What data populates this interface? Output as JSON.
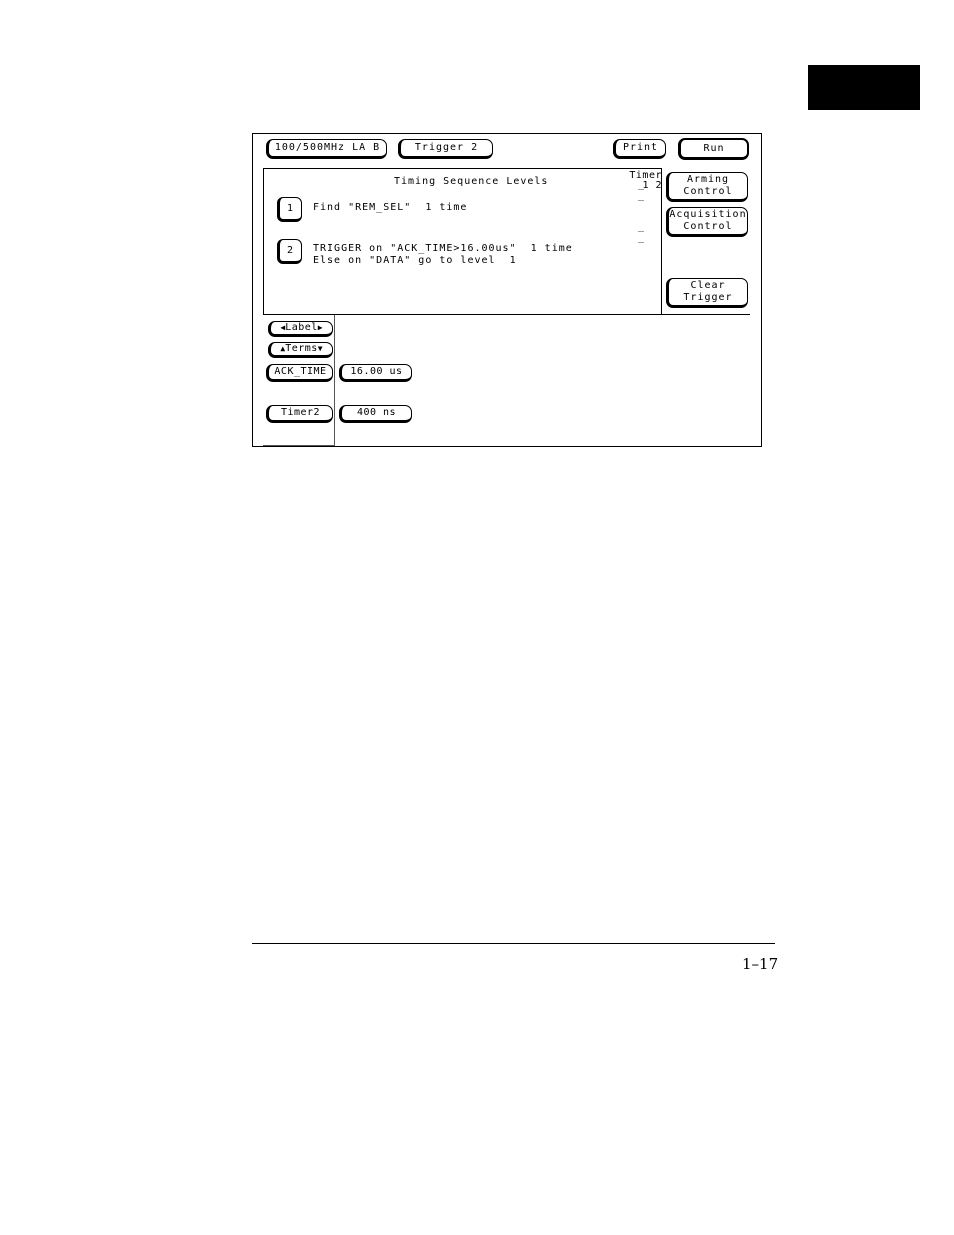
{
  "header": {
    "analyzer_label": "100/500MHz LA B",
    "menu_label": "Trigger 2",
    "print_label": "Print",
    "run_label": "Run"
  },
  "sequence": {
    "title": "Timing Sequence Levels",
    "timer_header": "Timer",
    "timer_columns": "1 2",
    "levels": [
      {
        "number": "1",
        "line1": "Find \"REM_SEL\"  1 time",
        "line2": "",
        "timer_marks": "_ _"
      },
      {
        "number": "2",
        "line1": "TRIGGER on \"ACK_TIME>16.00us\"  1 time",
        "line2": "Else on \"DATA\" go to level  1",
        "timer_marks": "_ _"
      }
    ]
  },
  "side_buttons": {
    "arming": "Arming\nControl",
    "acquisition": "Acquisition\nControl",
    "clear": "Clear\nTrigger"
  },
  "terms": {
    "label_button": "Label",
    "terms_button": "Terms",
    "rows": [
      {
        "name": "ACK_TIME",
        "value": "16.00 us"
      },
      {
        "name": "Timer2",
        "value": "400 ns"
      }
    ]
  },
  "page": {
    "number": "1–17"
  }
}
